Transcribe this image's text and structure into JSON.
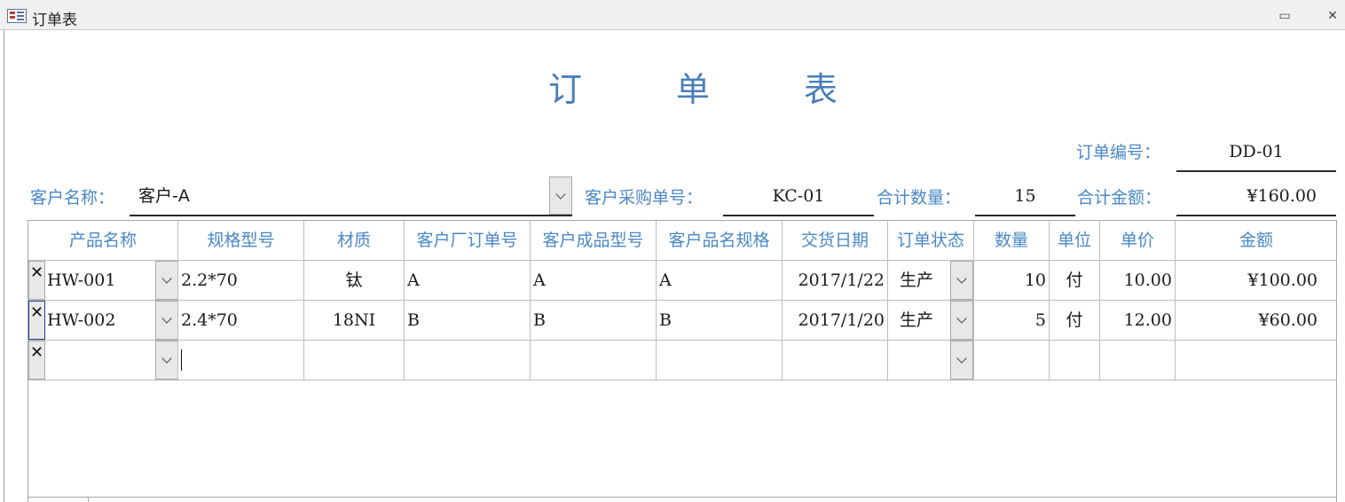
{
  "window": {
    "title": "订单表",
    "minimize_glyph": "▭",
    "close_glyph": "✕"
  },
  "form": {
    "heading": [
      "订",
      "单",
      "表"
    ],
    "order_no_label": "订单编号：",
    "order_no_value": "DD-01",
    "customer_label": "客户名称：",
    "customer_value": "客户-A",
    "po_label": "客户采购单号：",
    "po_value": "KC-01",
    "total_qty_label": "合计数量：",
    "total_qty_value": "15",
    "total_amount_label": "合计金额：",
    "total_amount_value": "¥160.00"
  },
  "grid": {
    "columns": [
      "产品名称",
      "规格型号",
      "材质",
      "客户厂订单号",
      "客户成品型号",
      "客户品名规格",
      "交货日期",
      "订单状态",
      "数量",
      "单位",
      "单价",
      "金额"
    ],
    "rows": [
      {
        "product": "HW-001",
        "spec": "2.2*70",
        "material": "钛",
        "cust_order": "A",
        "cust_model": "A",
        "cust_name": "A",
        "date": "2017/1/22",
        "status": "生产",
        "qty": "10",
        "unit": "付",
        "price": "10.00",
        "amount": "¥100.00"
      },
      {
        "product": "HW-002",
        "spec": "2.4*70",
        "material": "18NI",
        "cust_order": "B",
        "cust_model": "B",
        "cust_name": "B",
        "date": "2017/1/20",
        "status": "生产",
        "qty": "5",
        "unit": "付",
        "price": "12.00",
        "amount": "¥60.00"
      }
    ],
    "row_selector_glyph": "✕"
  }
}
